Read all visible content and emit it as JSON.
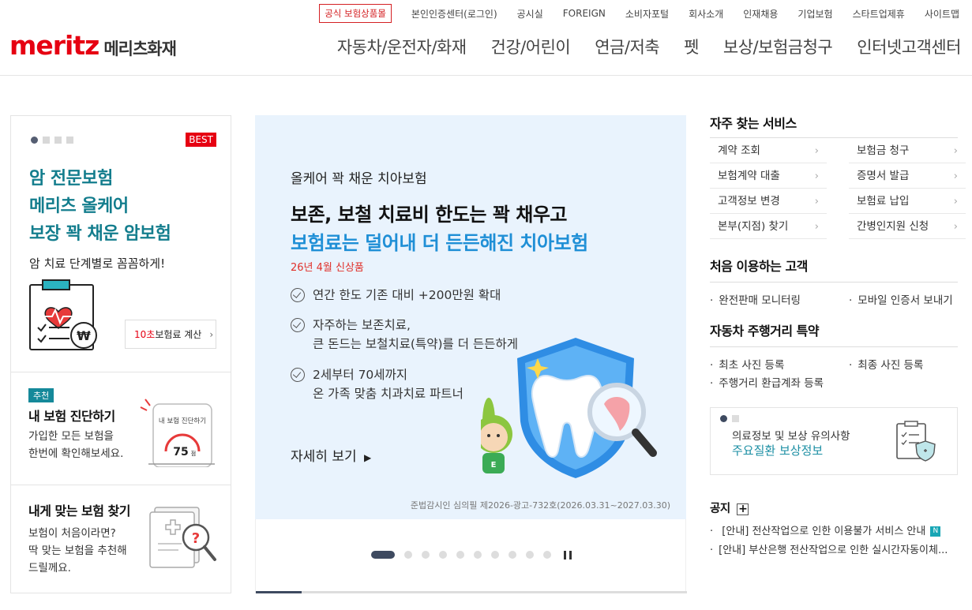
{
  "header": {
    "logo_en": "meritz",
    "logo_ko": "메리츠화재",
    "official_products": "공식 보험상품몰",
    "util": [
      "본인인증센터(로그인)",
      "공시실",
      "FOREIGN",
      "소비자포털",
      "회사소개",
      "인재채용",
      "기업보험",
      "스타트업제휴",
      "사이트맵"
    ],
    "gnb": [
      "자동차/운전자/화재",
      "건강/어린이",
      "연금/저축",
      "펫",
      "보상/보험금청구",
      "인터넷고객센터"
    ]
  },
  "left": {
    "best": "BEST",
    "promo_lines": [
      "암 전문보험",
      "메리츠 올케어",
      "보장 꽉 채운 암보험"
    ],
    "promo_sub": "암 치료 단계별로 꼼꼼하게!",
    "calc_red": "10초",
    "calc_rest": " 보험료 계산",
    "diag_tag": "추천",
    "diag_title": "내 보험 진단하기",
    "diag_desc1": "가입한 모든 보험을",
    "diag_desc2": "한번에 확인해보세요.",
    "diag_phone_title": "내 보험 진단하기",
    "diag_score": "75",
    "diag_unit": "점",
    "find_title": "내게 맞는 보험 찾기",
    "find_desc1": "보험이 처음이라면?",
    "find_desc2": "딱 맞는 보험을 추천해",
    "find_desc3": "드릴께요."
  },
  "banner": {
    "eyebrow": "올케어 꽉 채운 치아보험",
    "headline1": "보존, 보철 치료비 한도는 꽉 채우고",
    "headline2": "보험료는 덜어내 더 든든해진 치아보험",
    "new_label": "26년 4월 신상품",
    "feature1": "연간 한도 기존 대비 +200만원 확대",
    "feature2a": "자주하는 보존치료,",
    "feature2b": "큰 돈드는 보철치료(특약)를 더 든든하게",
    "feature3a": "2세부터 70세까지",
    "feature3b": "온 가족 맞춤 치과치료 파트너",
    "more": "자세히 보기",
    "compliance": "준법감시인 심의필 제2026-광고-732호(2026.03.31~2027.03.30)",
    "slide_count": 10,
    "active_slide": 1
  },
  "right": {
    "frequent_title": "자주 찾는 서비스",
    "services": [
      "계약 조회",
      "보험금 청구",
      "보험계약 대출",
      "증명서 발급",
      "고객정보 변경",
      "보험료 납입",
      "본부(지점) 찾기",
      "간병인지원 신청"
    ],
    "first_title": "처음 이용하는 고객",
    "first_items": [
      "완전판매 모니터링",
      "모바일 인증서 보내기"
    ],
    "mileage_title": "자동차 주행거리 특약",
    "mileage_items": [
      "최초 사진 등록",
      "최종 사진 등록",
      "주행거리 환급계좌 등록"
    ],
    "info_line1": "의료정보 및 보상 유의사항",
    "info_line2": "주요질환 보상정보",
    "notice_title": "공지",
    "notices": [
      "[안내] 전산작업으로 인한 이용불가 서비스 안내",
      "[안내] 부산은행 전산작업으로 인한 실시간자동이체..."
    ],
    "new_badge": "N"
  },
  "colors": {
    "brand": "#e60012",
    "teal": "#137d8d",
    "blue": "#1f8fd6"
  }
}
